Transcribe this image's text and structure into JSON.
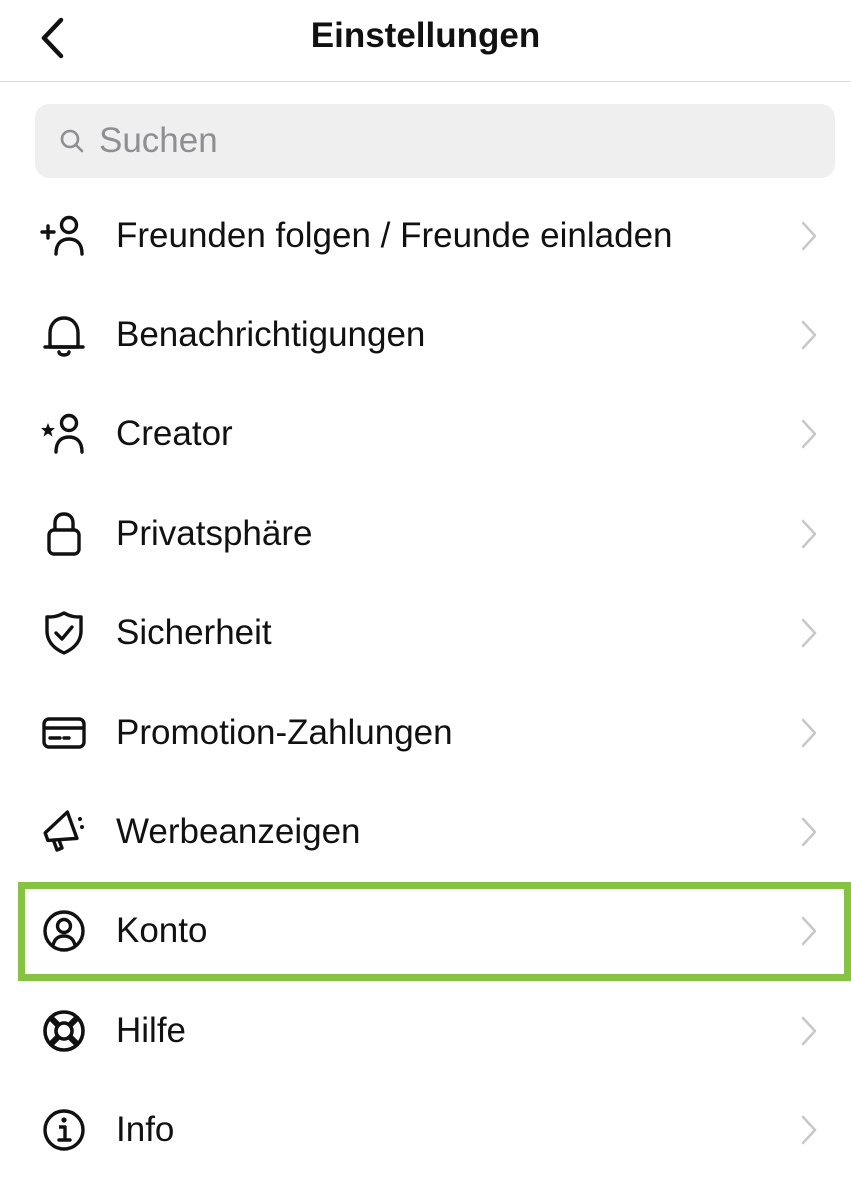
{
  "header": {
    "title": "Einstellungen",
    "back_icon": "chevron-left-icon"
  },
  "search": {
    "placeholder": "Suchen",
    "value": "",
    "icon": "search-icon"
  },
  "colors": {
    "highlight": "#86c342",
    "chevron": "#c7c7cc",
    "search_bg": "#efeff0",
    "placeholder": "#8e8e93"
  },
  "menu": {
    "items": [
      {
        "label": "Freunden folgen / Freunde einladen",
        "icon": "add-person-icon"
      },
      {
        "label": "Benachrichtigungen",
        "icon": "bell-icon"
      },
      {
        "label": "Creator",
        "icon": "star-person-icon"
      },
      {
        "label": "Privatsphäre",
        "icon": "lock-icon"
      },
      {
        "label": "Sicherheit",
        "icon": "shield-check-icon"
      },
      {
        "label": "Promotion-Zahlungen",
        "icon": "credit-card-icon"
      },
      {
        "label": "Werbeanzeigen",
        "icon": "megaphone-icon"
      },
      {
        "label": "Konto",
        "icon": "account-circle-icon",
        "highlighted": true
      },
      {
        "label": "Hilfe",
        "icon": "lifebuoy-icon"
      },
      {
        "label": "Info",
        "icon": "info-icon"
      }
    ]
  }
}
